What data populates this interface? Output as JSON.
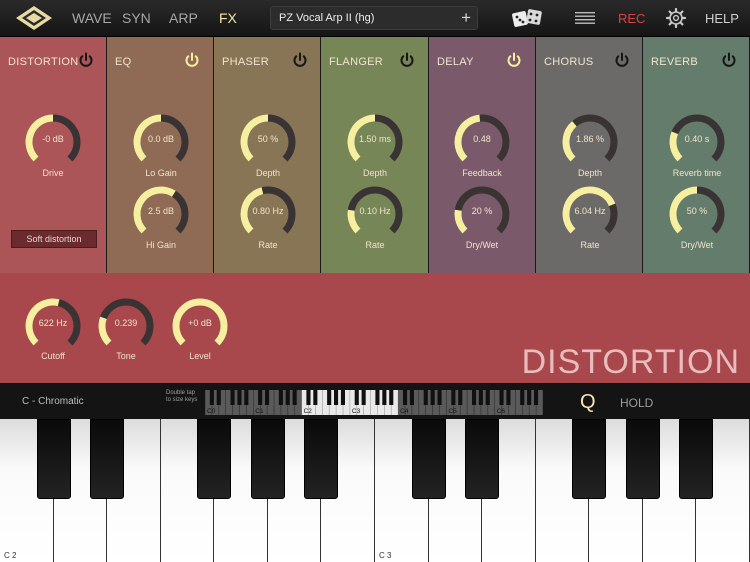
{
  "nav": {
    "tabs": [
      {
        "label": "WAVE",
        "active": false
      },
      {
        "label": "SYN",
        "active": false
      },
      {
        "label": "ARP",
        "active": false
      },
      {
        "label": "FX",
        "active": true
      }
    ],
    "preset": "PZ Vocal Arp II (hg)",
    "add_label": "+",
    "rec_label": "REC",
    "help_label": "HELP"
  },
  "colors": {
    "accent": "#f7efa0",
    "rec": "#d64343",
    "knob_track": "#3a3333"
  },
  "modules": [
    {
      "id": "distortion",
      "title": "DISTORTION",
      "power": "off",
      "knobs": [
        {
          "value": "-0 dB",
          "label": "Drive",
          "level": 0.5
        }
      ],
      "mode": "Soft distortion"
    },
    {
      "id": "eq",
      "title": "EQ",
      "power": "on",
      "knobs": [
        {
          "value": "0.0 dB",
          "label": "Lo Gain",
          "level": 0.5
        },
        {
          "value": "2.5 dB",
          "label": "Hi Gain",
          "level": 0.62
        }
      ]
    },
    {
      "id": "phaser",
      "title": "PHASER",
      "power": "off",
      "knobs": [
        {
          "value": "50 %",
          "label": "Depth",
          "level": 0.5
        },
        {
          "value": "0.80 Hz",
          "label": "Rate",
          "level": 0.45
        }
      ]
    },
    {
      "id": "flanger",
      "title": "FLANGER",
      "power": "off",
      "knobs": [
        {
          "value": "1.50  ms",
          "label": "Depth",
          "level": 0.5
        },
        {
          "value": "0.10  Hz",
          "label": "Rate",
          "level": 0.2
        }
      ]
    },
    {
      "id": "delay",
      "title": "DELAY",
      "power": "on",
      "knobs": [
        {
          "value": "0.48",
          "label": "Feedback",
          "level": 0.48
        },
        {
          "value": "20   %",
          "label": "Dry/Wet",
          "level": 0.2
        }
      ]
    },
    {
      "id": "chorus",
      "title": "CHORUS",
      "power": "off",
      "knobs": [
        {
          "value": "1.86 %",
          "label": "Depth",
          "level": 0.35
        },
        {
          "value": "6.04  Hz",
          "label": "Rate",
          "level": 0.75
        }
      ]
    },
    {
      "id": "reverb",
      "title": "REVERB",
      "power": "off",
      "knobs": [
        {
          "value": "0.40 s",
          "label": "Reverb time",
          "level": 0.25
        },
        {
          "value": "50 %",
          "label": "Dry/Wet",
          "level": 0.5
        }
      ]
    }
  ],
  "detail": {
    "title": "DISTORTION",
    "knobs": [
      {
        "value": "622 Hz",
        "label": "Cutoff",
        "level": 0.55
      },
      {
        "value": "0.239",
        "label": "Tone",
        "level": 0.24
      },
      {
        "value": "+0 dB",
        "label": "Level",
        "level": 1.0
      }
    ]
  },
  "keyboard": {
    "scale": "C - Chromatic",
    "hint_line1": "Double tap",
    "hint_line2": "to size keys",
    "octave_labels": [
      "C0",
      "C1",
      "C2",
      "C3",
      "C4",
      "C5",
      "C6"
    ],
    "q_label": "Q",
    "hold_label": "HOLD",
    "key_labels": [
      "C 2",
      "C 3"
    ]
  }
}
